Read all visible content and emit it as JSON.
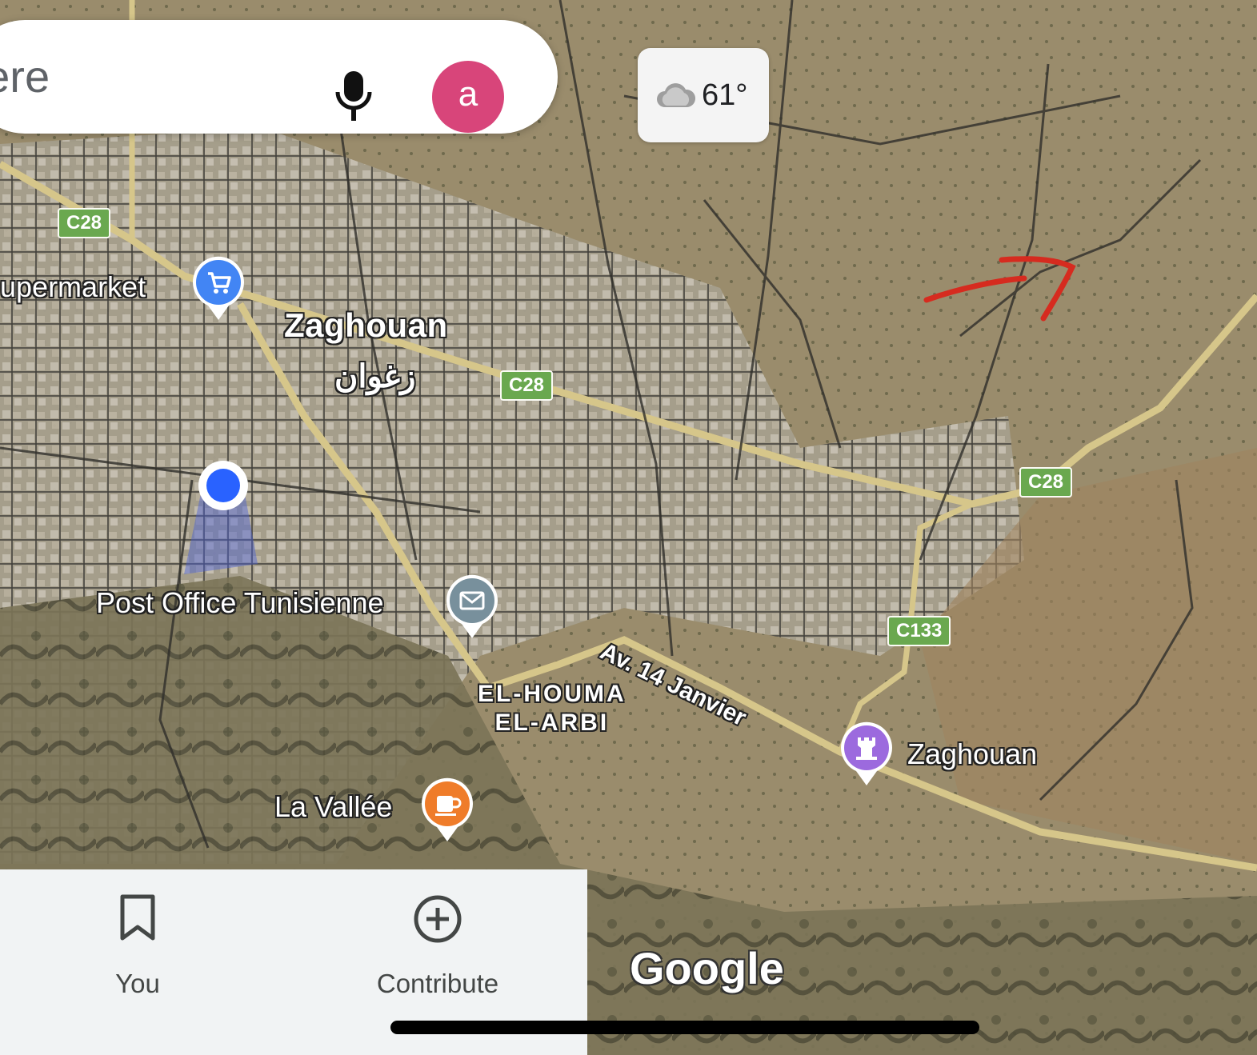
{
  "search": {
    "text": "here"
  },
  "avatar": {
    "letter": "a"
  },
  "weather": {
    "temp": "61°",
    "icon": "cloud-icon"
  },
  "map": {
    "labels": {
      "supermarket": "upermarket",
      "city": "Zaghouan",
      "city_ar": "زغوان",
      "post_office": "Post Office Tunisienne",
      "district_line1": "EL-HOUMA",
      "district_line2": "EL-ARBI",
      "street": "Av. 14 Janvier",
      "landmark": "Zaghouan",
      "cafe": "La Vallée"
    },
    "shields": {
      "c28_a": "C28",
      "c28_b": "C28",
      "c28_c": "C28",
      "c133": "C133"
    },
    "colors": {
      "shopping_pin": "#4285f4",
      "post_pin": "#78909c",
      "landmark_pin": "#9c6ade",
      "cafe_pin": "#ef7c2a",
      "location_dot": "#2962ff",
      "annotation": "#d62b1f",
      "route_shield": "#6aa84f"
    }
  },
  "bottom_nav": {
    "you": "You",
    "contribute": "Contribute"
  },
  "attribution": "Google"
}
